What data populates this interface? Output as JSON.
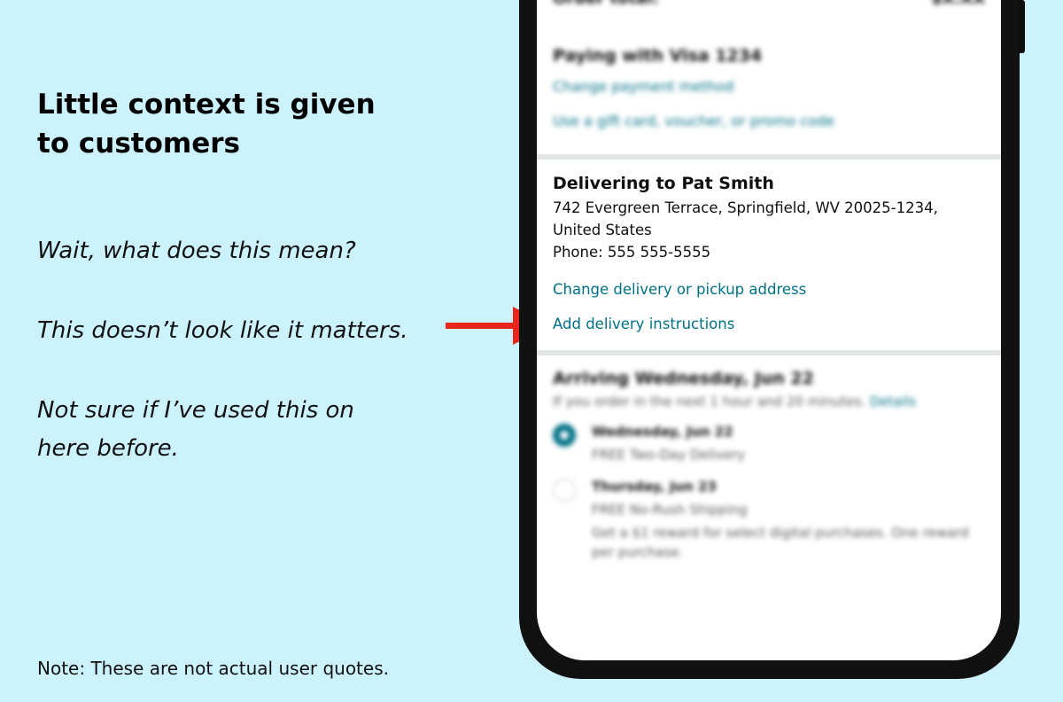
{
  "slide": {
    "headline": "Little context is given to customers",
    "quotes": [
      "Wait, what does this mean?",
      "This doesn’t look like it matters.",
      "Not sure if I’ve used this on here before."
    ],
    "note": "Note: These are not actual user quotes.",
    "arrow_color": "#e8261c",
    "background_color": "#ccf3fd"
  },
  "phone": {
    "order_total_label": "Order total:",
    "order_total_value": "$X.XX",
    "payment": {
      "title": "Paying with Visa 1234",
      "change_link": "Change payment method",
      "gift_link": "Use a gift card, voucher, or promo code"
    },
    "delivery": {
      "title": "Delivering to Pat Smith",
      "address_line1": "742 Evergreen Terrace, Springfield, WV 20025-1234,",
      "address_line2": "United States",
      "phone": "Phone: 555 555-5555",
      "change_link": "Change delivery or pickup address",
      "instructions_link": "Add delivery instructions"
    },
    "arrival": {
      "title": "Arriving Wednesday, Jun 22",
      "subtitle": "If you order in the next 1 hour and 20 minutes.",
      "details_link": "Details",
      "options": [
        {
          "date": "Wednesday, Jun 22",
          "desc": "FREE Two-Day Delivery",
          "selected": true
        },
        {
          "date": "Thursday, Jun 23",
          "desc": "FREE No-Rush Shipping",
          "extra": "Get a $1 reward for select digital purchases. One reward per purchase.",
          "selected": false
        }
      ]
    },
    "link_color": "#007185"
  }
}
